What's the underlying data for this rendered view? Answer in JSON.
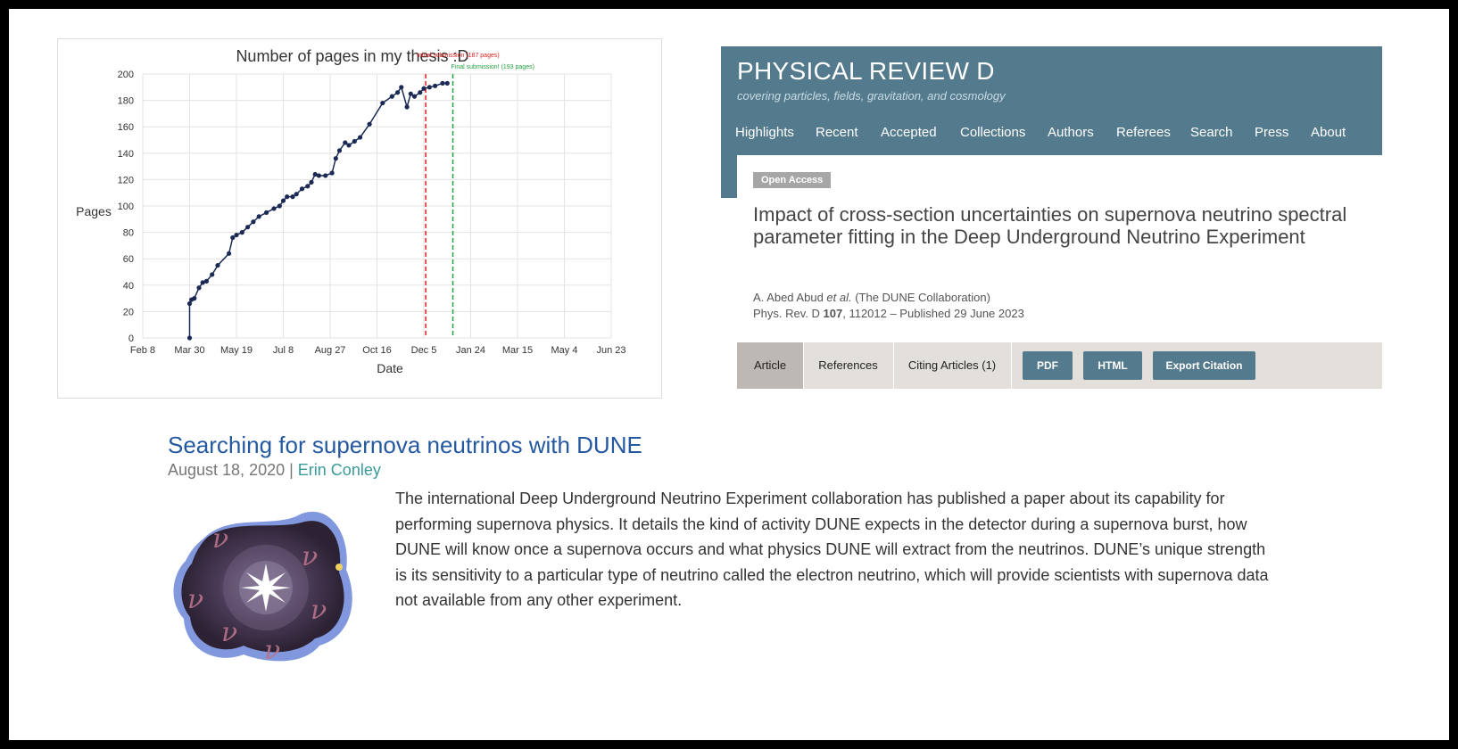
{
  "chart": {
    "chart_data": {
      "type": "line",
      "title": "Number of pages in my thesis :D",
      "xlabel": "Date",
      "ylabel": "Pages",
      "ylim": [
        0,
        200
      ],
      "yticks": [
        0,
        20,
        40,
        60,
        80,
        100,
        120,
        140,
        160,
        180,
        200
      ],
      "xticks": [
        "Feb 8",
        "Mar 30",
        "May 19",
        "Jul 8",
        "Aug 27",
        "Oct 16",
        "Dec 5",
        "Jan 24",
        "Mar 15",
        "May 4",
        "Jun 23"
      ],
      "grid": true,
      "series": [
        {
          "color": "#1b2a55",
          "x": [
            50,
            50,
            52,
            55,
            60,
            64,
            68,
            74,
            80,
            92,
            96,
            100,
            106,
            112,
            118,
            124,
            132,
            140,
            146,
            150,
            154,
            160,
            164,
            170,
            176,
            180,
            184,
            188,
            195,
            202,
            206,
            210,
            216,
            220,
            226,
            232,
            242,
            256,
            266,
            272,
            276,
            282,
            286,
            290,
            296,
            300,
            306,
            312,
            320,
            325
          ],
          "y": [
            0,
            26,
            29,
            30,
            38,
            42,
            43,
            48,
            55,
            64,
            76,
            78,
            80,
            84,
            88,
            92,
            95,
            98,
            100,
            104,
            107,
            107,
            109,
            113,
            115,
            118,
            124,
            123,
            123,
            125,
            136,
            142,
            148,
            146,
            149,
            152,
            162,
            178,
            183,
            186,
            190,
            175,
            185,
            183,
            186,
            189,
            190,
            191,
            193,
            193
          ]
        }
      ],
      "x_units": "days from Feb 8",
      "vlines": [
        {
          "x": 302,
          "label": "Initial submission (187 pages)",
          "color": "#e02020",
          "style": "dashed"
        },
        {
          "x": 331,
          "label": "Final submission! (193 pages)",
          "color": "#22a040",
          "style": "dashed"
        }
      ]
    }
  },
  "journal": {
    "title": "PHYSICAL REVIEW D",
    "subtitle": "covering particles, fields, gravitation, and cosmology",
    "nav": [
      "Highlights",
      "Recent",
      "Accepted",
      "Collections",
      "Authors",
      "Referees",
      "Search",
      "Press",
      "About"
    ],
    "badge": "Open Access",
    "article_title": "Impact of cross-section uncertainties on supernova neutrino spectral parameter fitting in the Deep Underground Neutrino Experiment",
    "authors_name": "A. Abed Abud ",
    "authors_etal": "et al.",
    "authors_collab": " (The DUNE Collaboration)",
    "citation_prefix": "Phys. Rev. D ",
    "citation_volume": "107",
    "citation_suffix": ", 112012 – Published 29 June 2023",
    "tabs": [
      "Article",
      "References",
      "Citing Articles (1)"
    ],
    "buttons": [
      "PDF",
      "HTML",
      "Export Citation"
    ]
  },
  "news": {
    "title": "Searching for supernova neutrinos with DUNE",
    "date": "August 18, 2020",
    "separator": " | ",
    "author": "Erin Conley",
    "image_glyph": "ν",
    "body": "The international Deep Underground Neutrino Experiment collaboration has published a paper about its capability for performing supernova physics. It details the kind of activity DUNE expects in the detector during a supernova burst, how DUNE will know once a supernova occurs and what physics DUNE will extract from the neutrinos. DUNE’s unique strength is its sensitivity to a particular type of neutrino called the electron neutrino, which will provide scientists with supernova data not available from any other experiment."
  }
}
